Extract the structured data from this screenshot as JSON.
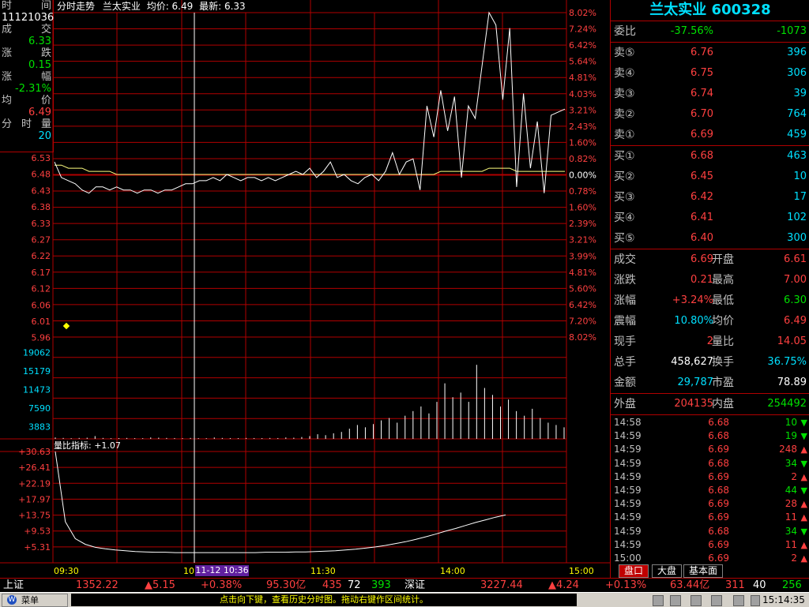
{
  "chart_header": {
    "title": "分时走势",
    "stock_name": "兰太实业",
    "avg_label": "均价: 6.49",
    "last_label": "最新: 6.33"
  },
  "left_info": {
    "time_label": [
      "时",
      "间"
    ],
    "time_value": "11121036",
    "deal_label": [
      "成",
      "交"
    ],
    "deal_value": "6.33",
    "change_label": [
      "涨",
      "跌"
    ],
    "change_value": "0.15",
    "pct_label": [
      "涨",
      "幅"
    ],
    "pct_value": "-2.31%",
    "avg_label": [
      "均",
      "价"
    ],
    "avg_value": "6.49",
    "vol_label": [
      "分",
      "时",
      "量"
    ],
    "vol_value": "20"
  },
  "price_axis_left": [
    "6.53",
    "6.48",
    "6.43",
    "6.38",
    "6.33",
    "6.27",
    "6.22",
    "6.17",
    "6.12",
    "6.06",
    "6.01",
    "5.96"
  ],
  "pct_axis_right": [
    "8.02%",
    "7.24%",
    "6.42%",
    "5.64%",
    "4.81%",
    "4.03%",
    "3.21%",
    "2.43%",
    "1.60%",
    "0.82%",
    "0.00%",
    "0.78%",
    "1.60%",
    "2.39%",
    "3.21%",
    "3.99%",
    "4.81%",
    "5.60%",
    "6.42%",
    "7.20%",
    "8.02%"
  ],
  "vol_axis_left": [
    "19062",
    "15179",
    "11473",
    "7590",
    "3883"
  ],
  "ratio_label": "量比指标: +1.07",
  "ratio_axis_left": [
    "+30.63",
    "+26.41",
    "+22.19",
    "+17.97",
    "+13.75",
    "+9.53",
    "+5.31"
  ],
  "time_axis": [
    "09:30",
    "10:",
    "11:30",
    "14:00",
    "15:00"
  ],
  "cursor_time": "11-12 10:36",
  "colors": {
    "up": "#ff4040",
    "down": "#00e000",
    "grid": "#b00000",
    "line": "#ffffff",
    "avg": "#ffff80",
    "cyan": "#00e0ff",
    "yellow": "#ffff00"
  },
  "right_panel": {
    "title": "兰太实业 600328",
    "weibi": {
      "label": "委比",
      "pct": "-37.56%",
      "diff": "-1073"
    },
    "sells": [
      {
        "label": "卖⑤",
        "price": "6.76",
        "vol": "396"
      },
      {
        "label": "卖④",
        "price": "6.75",
        "vol": "306"
      },
      {
        "label": "卖③",
        "price": "6.74",
        "vol": "39"
      },
      {
        "label": "卖②",
        "price": "6.70",
        "vol": "764"
      },
      {
        "label": "卖①",
        "price": "6.69",
        "vol": "459"
      }
    ],
    "buys": [
      {
        "label": "买①",
        "price": "6.68",
        "vol": "463"
      },
      {
        "label": "买②",
        "price": "6.45",
        "vol": "10"
      },
      {
        "label": "买③",
        "price": "6.42",
        "vol": "17"
      },
      {
        "label": "买④",
        "price": "6.41",
        "vol": "102"
      },
      {
        "label": "买⑤",
        "price": "6.40",
        "vol": "300"
      }
    ],
    "stats": [
      {
        "l1": "成交",
        "v1": "6.69",
        "l2": "开盘",
        "v2": "6.61",
        "c1": "red",
        "c2": "red"
      },
      {
        "l1": "涨跌",
        "v1": "0.21",
        "l2": "最高",
        "v2": "7.00",
        "c1": "red",
        "c2": "red"
      },
      {
        "l1": "涨幅",
        "v1": "+3.24%",
        "l2": "最低",
        "v2": "6.30",
        "c1": "red",
        "c2": "green"
      },
      {
        "l1": "震幅",
        "v1": "10.80%",
        "l2": "均价",
        "v2": "6.49",
        "c1": "cyan",
        "c2": "red"
      },
      {
        "l1": "现手",
        "v1": "2",
        "l2": "量比",
        "v2": "14.05",
        "c1": "red",
        "c2": "red"
      },
      {
        "l1": "总手",
        "v1": "458,627",
        "l2": "换手",
        "v2": "36.75%",
        "c1": "white",
        "c2": "cyan"
      },
      {
        "l1": "金额",
        "v1": "29,787",
        "l2": "市盈",
        "v2": "78.89",
        "c1": "cyan",
        "c2": "white"
      }
    ],
    "outer": {
      "l1": "外盘",
      "v1": "204135",
      "l2": "内盘",
      "v2": "254492"
    },
    "ticks": [
      {
        "t": "14:58",
        "p": "6.68",
        "v": "10",
        "d": "down"
      },
      {
        "t": "14:59",
        "p": "6.68",
        "v": "19",
        "d": "down"
      },
      {
        "t": "14:59",
        "p": "6.69",
        "v": "248",
        "d": "up"
      },
      {
        "t": "14:59",
        "p": "6.68",
        "v": "34",
        "d": "down"
      },
      {
        "t": "14:59",
        "p": "6.69",
        "v": "2",
        "d": "up"
      },
      {
        "t": "14:59",
        "p": "6.68",
        "v": "44",
        "d": "down"
      },
      {
        "t": "14:59",
        "p": "6.69",
        "v": "28",
        "d": "up"
      },
      {
        "t": "14:59",
        "p": "6.69",
        "v": "11",
        "d": "up"
      },
      {
        "t": "14:59",
        "p": "6.68",
        "v": "34",
        "d": "down"
      },
      {
        "t": "14:59",
        "p": "6.69",
        "v": "11",
        "d": "up"
      },
      {
        "t": "15:00",
        "p": "6.69",
        "v": "2",
        "d": "up"
      }
    ],
    "tabs": [
      "盘口",
      "大盘",
      "基本面"
    ]
  },
  "status_bar": {
    "sh_label": "上证",
    "sh_index": "1352.22",
    "sh_change": "▲5.15",
    "sh_pct": "+0.38%",
    "sh_amount": "95.30亿",
    "sh_up": "435",
    "sh_flat": "72",
    "sh_down": "393",
    "sz_label": "深证",
    "sz_index": "3227.44",
    "sz_change": "▲4.24",
    "sz_pct": "+0.13%",
    "sz_amount": "63.44亿",
    "sz_up": "311",
    "sz_flat": "40",
    "sz_down": "256"
  },
  "bottom_bar": {
    "menu_label": "菜单",
    "hint": "点击向下键，查看历史分时图。拖动右键作区间统计。",
    "clock": "15:14:35"
  },
  "chart_data": [
    {
      "type": "line",
      "series": [
        {
          "values": [
            6.52,
            6.47,
            6.46,
            6.45,
            6.43,
            6.42,
            6.44,
            6.44,
            6.43,
            6.44,
            6.43,
            6.43,
            6.42,
            6.43,
            6.43,
            6.42,
            6.43,
            6.43,
            6.44,
            6.45,
            6.45,
            6.46,
            6.46,
            6.47,
            6.46,
            6.48,
            6.47,
            6.46,
            6.47,
            6.47,
            6.46,
            6.47,
            6.46,
            6.47,
            6.48,
            6.49,
            6.48,
            6.5,
            6.47,
            6.49,
            6.52,
            6.47,
            6.48,
            6.46,
            6.45,
            6.47,
            6.48,
            6.46,
            6.49,
            6.55,
            6.48,
            6.52,
            6.53,
            6.43,
            6.7,
            6.6,
            6.75,
            6.62,
            6.73,
            6.47,
            6.7,
            6.66,
            6.83,
            7.0,
            6.96,
            6.72,
            6.95,
            6.44,
            6.74,
            6.5,
            6.65,
            6.42,
            6.67,
            6.68,
            6.69
          ]
        },
        {
          "values": [
            6.51,
            6.51,
            6.5,
            6.5,
            6.5,
            6.49,
            6.49,
            6.49,
            6.49,
            6.48,
            6.48,
            6.48,
            6.48,
            6.48,
            6.48,
            6.48,
            6.48,
            6.48,
            6.48,
            6.48,
            6.48,
            6.48,
            6.48,
            6.48,
            6.48,
            6.48,
            6.48,
            6.48,
            6.48,
            6.48,
            6.48,
            6.48,
            6.48,
            6.48,
            6.48,
            6.48,
            6.48,
            6.48,
            6.48,
            6.48,
            6.48,
            6.48,
            6.48,
            6.48,
            6.48,
            6.48,
            6.48,
            6.48,
            6.48,
            6.48,
            6.48,
            6.48,
            6.48,
            6.48,
            6.48,
            6.48,
            6.49,
            6.49,
            6.49,
            6.49,
            6.49,
            6.49,
            6.49,
            6.5,
            6.5,
            6.5,
            6.5,
            6.49,
            6.49,
            6.49,
            6.49,
            6.49,
            6.49,
            6.49,
            6.49
          ]
        }
      ],
      "ylim": [
        5.96,
        6.53
      ]
    },
    {
      "type": "bar",
      "values": [
        300,
        200,
        150,
        200,
        250,
        600,
        200,
        150,
        180,
        200,
        160,
        150,
        300,
        250,
        200,
        180,
        150,
        200,
        160,
        150,
        300,
        200,
        180,
        160,
        200,
        180,
        170,
        200,
        180,
        300,
        250,
        400,
        600,
        1000,
        800,
        1200,
        1500,
        2200,
        3000,
        2500,
        3200,
        4000,
        4500,
        3500,
        5000,
        6000,
        7000,
        5500,
        8000,
        12000,
        9000,
        10000,
        8000,
        16000,
        11000,
        9500,
        7000,
        8500,
        6000,
        5000,
        6500,
        4500,
        3500,
        3000,
        2500
      ],
      "ylim": [
        0,
        22000
      ]
    },
    {
      "type": "line",
      "series": [
        {
          "values": [
            30.6,
            12.0,
            7.5,
            6.0,
            5.2,
            4.8,
            4.5,
            4.3,
            4.1,
            4.0,
            3.9,
            3.9,
            3.8,
            3.8,
            3.8,
            3.8,
            3.8,
            3.8,
            3.8,
            3.8,
            3.8,
            3.9,
            3.9,
            3.9,
            4.0,
            4.0,
            4.1,
            4.2,
            4.3,
            4.5,
            4.7,
            5.0,
            5.3,
            5.7,
            6.2,
            6.7,
            7.3,
            8.0,
            8.7,
            9.5,
            10.2,
            11.0,
            11.8,
            12.5,
            13.2,
            13.8
          ]
        }
      ],
      "ylim": [
        1.1,
        30.63
      ]
    }
  ]
}
